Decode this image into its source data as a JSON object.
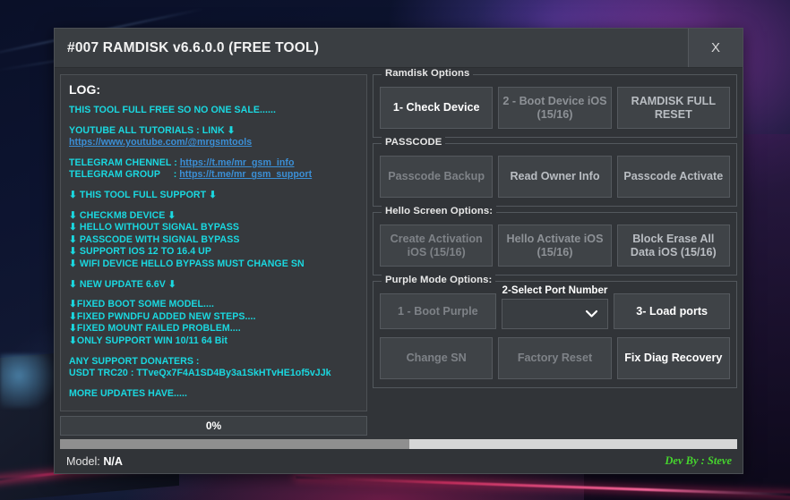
{
  "window": {
    "title": "#007 RAMDISK v6.6.0.0 (FREE TOOL)",
    "close_label": "X"
  },
  "log": {
    "heading": "LOG:",
    "lines": [
      {
        "text": "THIS TOOL FULL FREE SO NO ONE SALE......",
        "type": "text"
      },
      {
        "text": "",
        "type": "spacer"
      },
      {
        "text": "YOUTUBE ALL TUTORIALS : LINK ⬇",
        "type": "text"
      },
      {
        "text": "https://www.youtube.com/@mrgsmtools",
        "type": "link"
      },
      {
        "text": "",
        "type": "spacer"
      },
      {
        "text": "TELEGRAM CHENNEL : ",
        "link": "https://t.me/mr_gsm_info",
        "type": "mixed"
      },
      {
        "text": "TELEGRAM GROUP     : ",
        "link": "https://t.me/mr_gsm_support",
        "type": "mixed"
      },
      {
        "text": "",
        "type": "spacer"
      },
      {
        "text": "⬇ THIS TOOL FULL SUPPORT ⬇",
        "type": "text"
      },
      {
        "text": "",
        "type": "spacer"
      },
      {
        "text": "⬇ CHECKM8 DEVICE ⬇",
        "type": "text"
      },
      {
        "text": "⬇ HELLO WITHOUT SIGNAL BYPASS",
        "type": "text"
      },
      {
        "text": "⬇ PASSCODE WITH SIGNAL BYPASS",
        "type": "text"
      },
      {
        "text": "⬇ SUPPORT IOS 12 TO 16.4 UP",
        "type": "text"
      },
      {
        "text": "⬇ WIFI DEVICE HELLO BYPASS MUST CHANGE SN",
        "type": "text"
      },
      {
        "text": "",
        "type": "spacer"
      },
      {
        "text": "⬇ NEW UPDATE 6.6V ⬇",
        "type": "text"
      },
      {
        "text": "",
        "type": "spacer"
      },
      {
        "text": "⬇FIXED BOOT SOME MODEL....",
        "type": "text"
      },
      {
        "text": "⬇FIXED PWNDFU ADDED NEW STEPS....",
        "type": "text"
      },
      {
        "text": "⬇FIXED MOUNT FAILED PROBLEM....",
        "type": "text"
      },
      {
        "text": "⬇ONLY SUPPORT WIN 10/11 64 Bit",
        "type": "text"
      },
      {
        "text": "",
        "type": "spacer"
      },
      {
        "text": "ANY SUPPORT DONATERS :",
        "type": "text"
      },
      {
        "text": "USDT TRC20 : TTveQx7F4A1SD4By3a1SkHTvHE1of5vJJk",
        "type": "text"
      },
      {
        "text": "",
        "type": "spacer"
      },
      {
        "text": "MORE UPDATES HAVE.....",
        "type": "text"
      }
    ]
  },
  "progress": {
    "percent_label": "0%",
    "value": 0
  },
  "groups": {
    "ramdisk": {
      "legend": "Ramdisk Options",
      "buttons": [
        {
          "label": "1- Check Device",
          "state": "enabled"
        },
        {
          "label": "2 - Boot Device iOS (15/16)",
          "state": "disabled"
        },
        {
          "label": "RAMDISK FULL RESET",
          "state": "mid"
        }
      ]
    },
    "passcode": {
      "legend": "PASSCODE",
      "buttons": [
        {
          "label": "Passcode Backup",
          "state": "dim"
        },
        {
          "label": "Read Owner Info",
          "state": "mid"
        },
        {
          "label": "Passcode Activate",
          "state": "mid"
        }
      ]
    },
    "hello": {
      "legend": "Hello Screen Options:",
      "buttons": [
        {
          "label": "Create Activation iOS (15/16)",
          "state": "dim"
        },
        {
          "label": "Hello Activate iOS (15/16)",
          "state": "disabled"
        },
        {
          "label": "Block Erase All Data iOS (15/16)",
          "state": "mid"
        }
      ]
    },
    "purple": {
      "legend": "Purple Mode Options:",
      "row1": {
        "boot_button": {
          "label": "1 - Boot Purple",
          "state": "dim"
        },
        "select": {
          "caption": "2-Select Port Number",
          "value": "",
          "placeholder": "",
          "icon": "chevron-down-icon"
        },
        "load_button": {
          "label": "3- Load ports",
          "state": "enabled"
        }
      },
      "row2": [
        {
          "label": "Change SN",
          "state": "dim"
        },
        {
          "label": "Factory Reset",
          "state": "dim"
        },
        {
          "label": "Fix Diag Recovery",
          "state": "enabled"
        }
      ]
    }
  },
  "statusbar": {
    "model_prefix": "Model: ",
    "model_value": "N/A",
    "dev_by": "Dev By : Steve"
  },
  "colors": {
    "log_text": "#1ad8e0",
    "log_link": "#3b8fd6",
    "dev_by": "#46d62e",
    "window_bg": "#313438",
    "button_bg": "#3f4347"
  }
}
